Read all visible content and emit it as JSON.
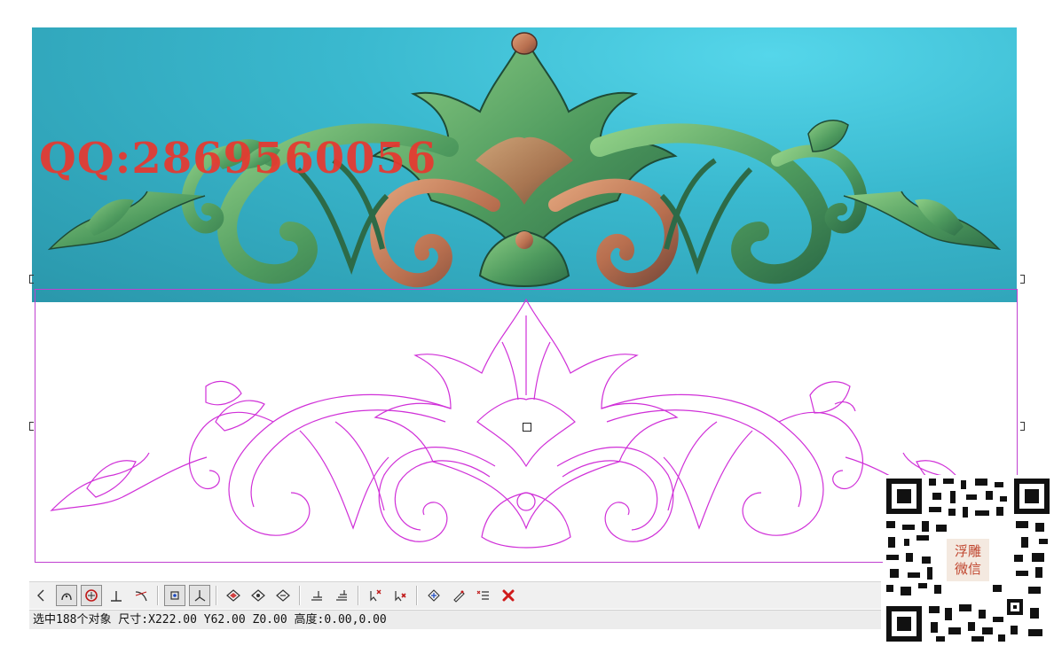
{
  "watermark": {
    "text": "QQ:2869560056"
  },
  "status_bar": {
    "text": "选中188个对象 尺寸:X222.00 Y62.00 Z0.00 高度:0.00,0.00"
  },
  "qr_badge": {
    "line1": "浮雕",
    "line2": "微信"
  },
  "colors": {
    "outline": "#d030d8",
    "relief_green": "#5aa063",
    "relief_copper": "#c07a55",
    "background_cyan": "#3ab9cf",
    "watermark_red": "#e8382f"
  },
  "toolbar": {
    "tools": [
      "arc-partial-icon",
      "arc-tool-icon",
      "circle-center-icon",
      "perpendicular-icon",
      "tangent-icon",
      "node-snap-icon",
      "axis-snap-icon",
      "diamond-node-icon",
      "diamond-edit-icon",
      "diamond-smooth-icon",
      "layer-stack-icon",
      "layer-align-icon",
      "cursor-cross-icon",
      "cursor-delete-icon",
      "transform-icon",
      "pen-edit-icon",
      "text-list-icon",
      "delete-icon"
    ]
  }
}
